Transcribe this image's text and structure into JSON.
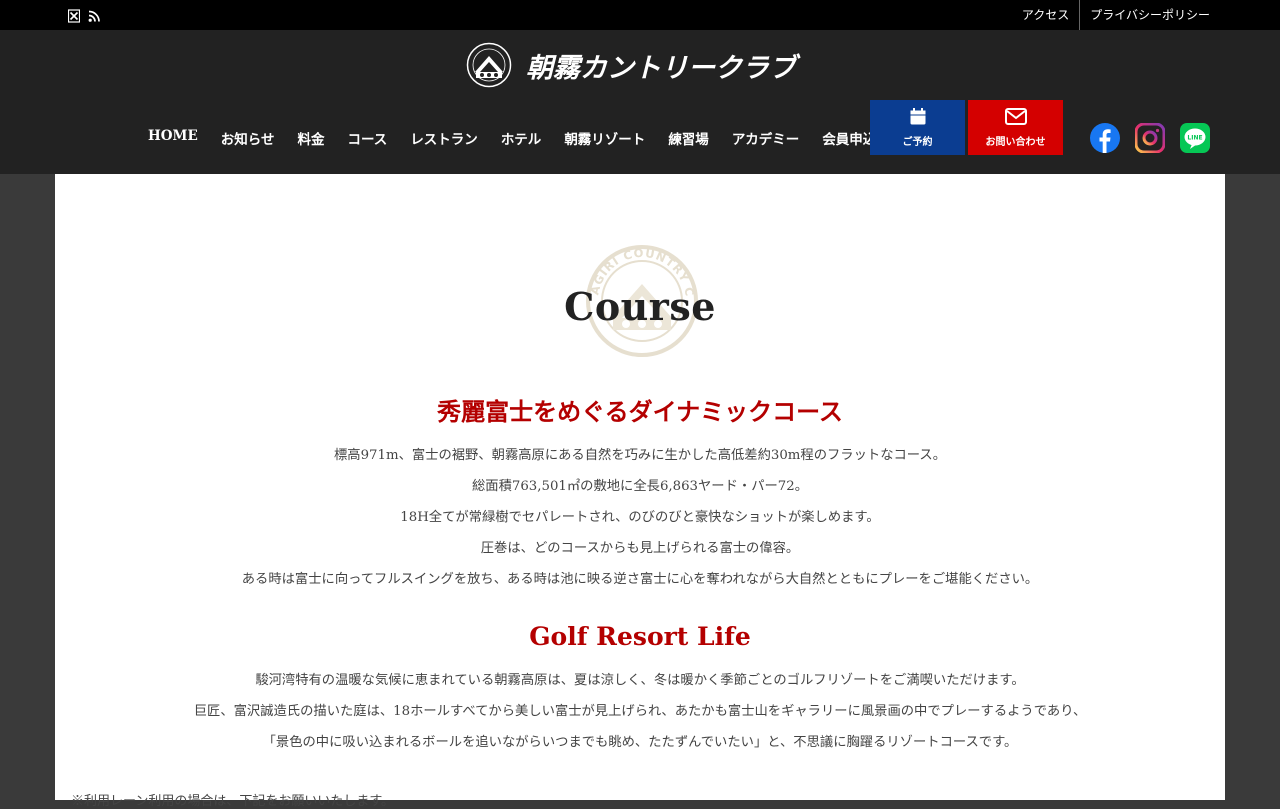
{
  "topbar": {
    "icons": [
      "x-social-icon",
      "rss-icon"
    ],
    "links": [
      "アクセス",
      "プライバシーポリシー"
    ]
  },
  "header": {
    "logo_text": "朝霧カントリークラブ",
    "nav": [
      "HOME",
      "お知らせ",
      "料金",
      "コース",
      "レストラン",
      "ホテル",
      "朝霧リゾート",
      "練習場",
      "アカデミー",
      "会員申込"
    ],
    "reserve_label": "ご予約",
    "contact_label": "お問い合わせ",
    "sns": [
      "facebook-icon",
      "instagram-icon",
      "line-icon"
    ],
    "colors": {
      "reserve": "#0b3d91",
      "contact": "#d40000",
      "accent": "#b40000"
    }
  },
  "main": {
    "emblem_text": "AGIRI COUNTRY CLUB",
    "page_title": "Course",
    "section1": {
      "title": "秀麗富士をめぐるダイナミックコース",
      "paragraphs": [
        "標高971m、富士の裾野、朝霧高原にある自然を巧みに生かした高低差約30m程のフラットなコース。",
        "総面積763,501㎡の敷地に全長6,863ヤード・パー72。",
        "18H全てが常緑樹でセパレートされ、のびのびと豪快なショットが楽しめます。",
        "圧巻は、どのコースからも見上げられる富士の偉容。",
        "ある時は富士に向ってフルスイングを放ち、ある時は池に映る逆さ富士に心を奪われながら大自然とともにプレーをご堪能ください。"
      ]
    },
    "section2": {
      "title": "Golf Resort Life",
      "paragraphs": [
        "駿河湾特有の温暖な気候に恵まれている朝霧高原は、夏は涼しく、冬は暖かく季節ごとのゴルフリゾートをご満喫いただけます。",
        "巨匠、富沢誠造氏の描いた庭は、18ホールすべてから美しい富士が見上げられ、あたかも富士山をギャラリーに風景画の中でプレーするようであり、",
        "「景色の中に吸い込まれるボールを追いながらいつまでも眺め、たたずんでいたい」と、不思議に胸躍るリゾートコースです。"
      ]
    },
    "note": "※利用レーン利用の場合は、下記をお願いいたします。"
  }
}
